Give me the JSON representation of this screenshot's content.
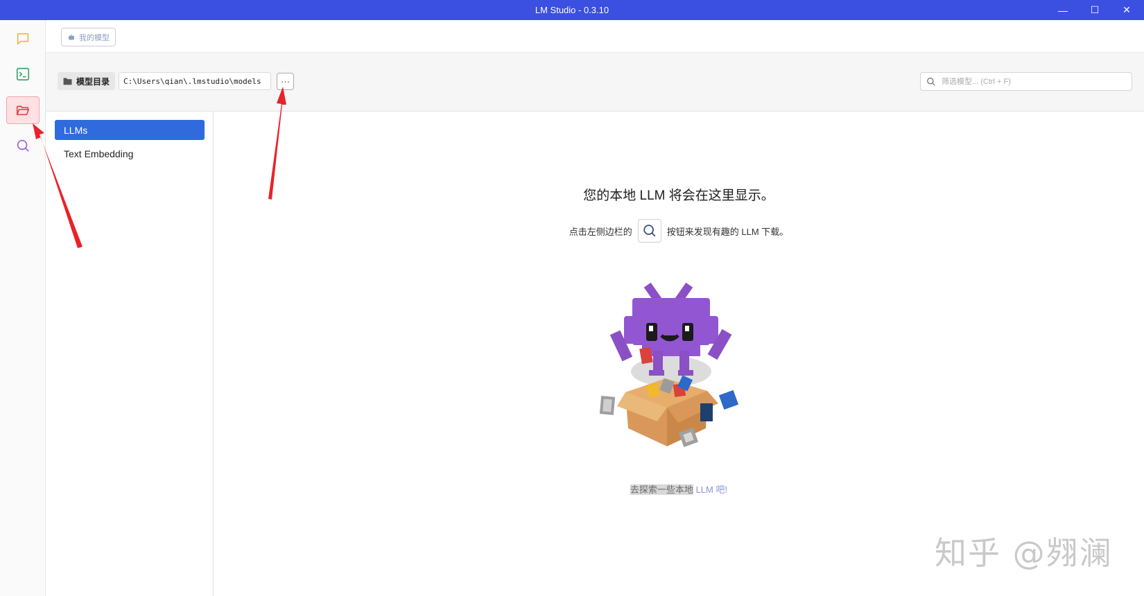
{
  "window": {
    "title": "LM Studio - 0.3.10",
    "controls": {
      "minimize": "—",
      "maximize": "☐",
      "close": "✕"
    }
  },
  "rail": {
    "items": [
      {
        "name": "chat",
        "icon": "chat-icon",
        "color": "#e7b84a"
      },
      {
        "name": "developer",
        "icon": "terminal-icon",
        "color": "#3aa56f"
      },
      {
        "name": "my-models",
        "icon": "folder-open-icon",
        "color": "#e0424f",
        "active": true
      },
      {
        "name": "discover",
        "icon": "search-icon",
        "color": "#9c5bd8"
      }
    ]
  },
  "header": {
    "my_models_button": "我的模型"
  },
  "directory": {
    "label": "模型目录",
    "path": "C:\\Users\\qian\\.lmstudio\\models",
    "more_label": "···"
  },
  "filter": {
    "placeholder": "筛选模型... (Ctrl + F)"
  },
  "categories": [
    {
      "label": "LLMs",
      "active": true
    },
    {
      "label": "Text Embedding",
      "active": false
    }
  ],
  "empty_state": {
    "title": "您的本地 LLM 将会在这里显示。",
    "sub_before": "点击左侧边栏的",
    "sub_after": "按钮来发现有趣的 LLM 下载。",
    "explore_highlight": "去探索一些本地",
    "explore_link": "LLM 吧!"
  },
  "watermark": "知乎 @翙澜",
  "colors": {
    "titlebar": "#3b4fe0",
    "accent": "#2f6bdc",
    "annotation_arrow": "#e8232a"
  }
}
